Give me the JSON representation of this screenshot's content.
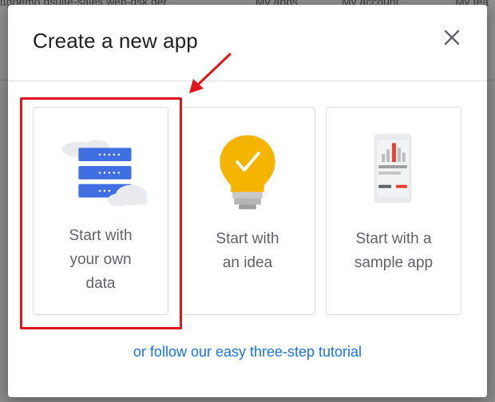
{
  "background": {
    "url_fragment": "ttgdemo dsuite-sales web-dsk der",
    "nav_my_apps": "My apps",
    "nav_my_account": "My account",
    "nav_my_team": "My tea"
  },
  "dialog": {
    "title": "Create a new app",
    "close_icon": "close-icon",
    "cards": [
      {
        "label_lines": [
          "Start with",
          "your own",
          "data"
        ],
        "icon": "server-cloud-icon"
      },
      {
        "label_lines": [
          "Start with",
          "an idea"
        ],
        "icon": "lightbulb-check-icon"
      },
      {
        "label_lines": [
          "Start with a",
          "sample app"
        ],
        "icon": "phone-chart-icon"
      }
    ],
    "tutorial_link": "or follow our easy three-step tutorial"
  },
  "colors": {
    "accent_link": "#1a73e8",
    "highlight": "#e0161b",
    "server_blue": "#3f6fe0",
    "bulb_yellow": "#f5b400",
    "chart_red": "#ea4335"
  }
}
